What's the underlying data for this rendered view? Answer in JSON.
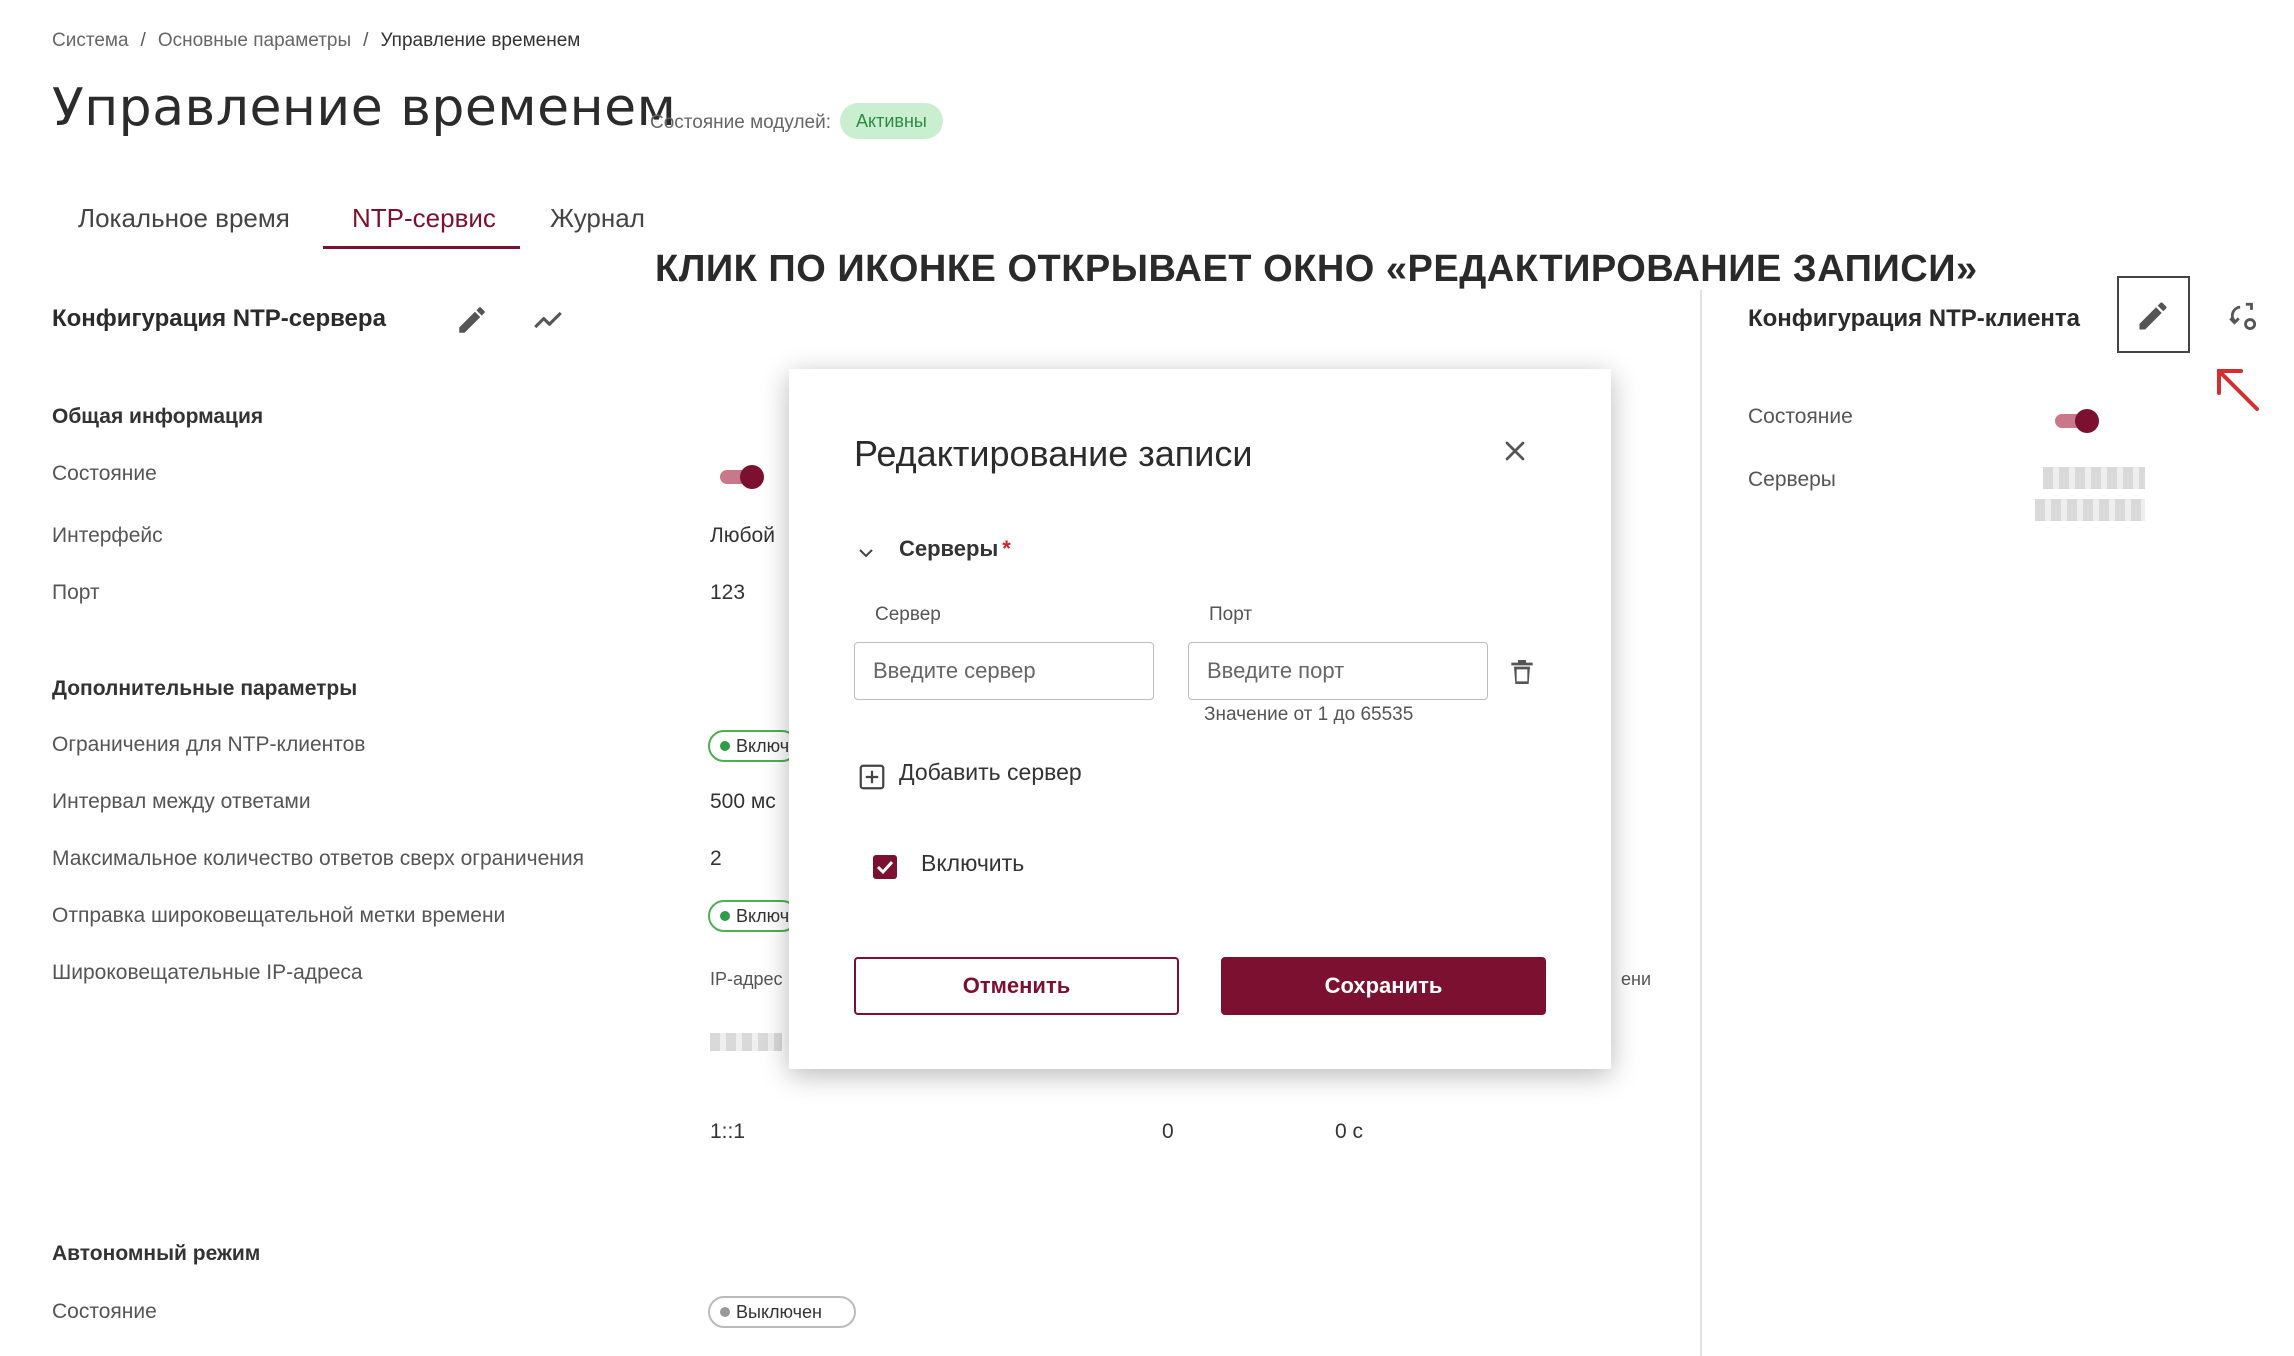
{
  "breadcrumb": {
    "items": [
      "Система",
      "Основные параметры",
      "Управление временем"
    ],
    "separator": "/"
  },
  "page": {
    "title": "Управление временем",
    "modules_label": "Состояние модулей:",
    "modules_status": "Активны"
  },
  "tabs": [
    "Локальное время",
    "NTP-сервис",
    "Журнал"
  ],
  "annotation": "КЛИК ПО ИКОНКЕ ОТКРЫВАЕТ ОКНО «РЕДАКТИРОВАНИЕ ЗАПИСИ»",
  "server_config": {
    "title": "Конфигурация NTP-сервера",
    "general_title": "Общая информация",
    "state_label": "Состояние",
    "interface_label": "Интерфейс",
    "interface_value": "Любой",
    "port_label": "Порт",
    "port_value": "123",
    "extra_title": "Дополнительные параметры",
    "limits_label": "Ограничения для NTP-клиентов",
    "limits_value": "Включен",
    "interval_label": "Интервал между ответами",
    "interval_value": "500 мс",
    "max_label": "Максимальное количество ответов сверх ограничения",
    "max_value": "2",
    "broadcast_label": "Отправка широковещательной метки времени",
    "broadcast_value": "Включен",
    "bcast_ip_label": "Широковещательные IP-адреса",
    "table_col_ip": "IP-адрес",
    "table_col_time": "ени",
    "row2_ip": "1::1",
    "row2_val1": "0",
    "row2_val2": "0 с",
    "autonomous_title": "Автономный режим",
    "autonomous_state_label": "Состояние",
    "autonomous_state_value": "Выключен"
  },
  "client_config": {
    "title": "Конфигурация NTP-клиента",
    "state_label": "Состояние",
    "servers_label": "Серверы"
  },
  "modal": {
    "title": "Редактирование записи",
    "section": "Серверы",
    "required_mark": "*",
    "server_label": "Сервер",
    "server_placeholder": "Введите сервер",
    "port_label": "Порт",
    "port_placeholder": "Введите порт",
    "port_hint": "Значение от 1 до 65535",
    "add_server": "Добавить сервер",
    "enable_label": "Включить",
    "enable_checked": true,
    "cancel": "Отменить",
    "save": "Сохранить"
  },
  "colors": {
    "accent": "#7b1030",
    "success": "#2e9c48",
    "annotation_arrow": "#d32f2f"
  },
  "icons": [
    "pencil-icon",
    "chart-line-icon",
    "sync-settings-icon",
    "close-icon",
    "chevron-down-icon",
    "trash-icon",
    "plus-box-icon",
    "check-icon",
    "arrow-up-left-icon"
  ]
}
